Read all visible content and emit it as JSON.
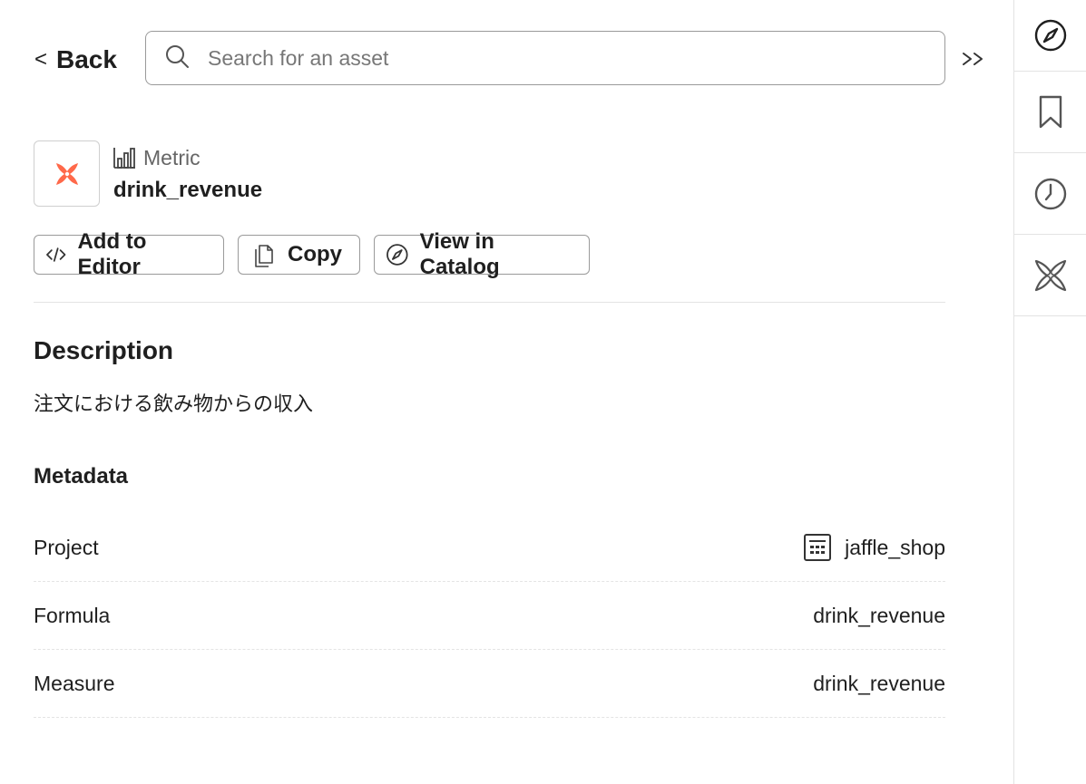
{
  "header": {
    "back_label": "Back",
    "search_placeholder": "Search for an asset"
  },
  "asset": {
    "type_label": "Metric",
    "name": "drink_revenue",
    "brand_color": "#FF694A"
  },
  "actions": {
    "add_to_editor": "Add to Editor",
    "copy": "Copy",
    "view_in_catalog": "View in Catalog"
  },
  "description": {
    "title": "Description",
    "text": "注文における飲み物からの収入"
  },
  "metadata": {
    "title": "Metadata",
    "rows": [
      {
        "label": "Project",
        "value": "jaffle_shop",
        "icon": "project-table-icon"
      },
      {
        "label": "Formula",
        "value": "drink_revenue"
      },
      {
        "label": "Measure",
        "value": "drink_revenue"
      }
    ]
  },
  "sidebar": {
    "items": [
      {
        "icon": "compass-icon",
        "active": true
      },
      {
        "icon": "bookmark-icon"
      },
      {
        "icon": "clock-icon"
      },
      {
        "icon": "dbt-logo-icon"
      }
    ]
  }
}
